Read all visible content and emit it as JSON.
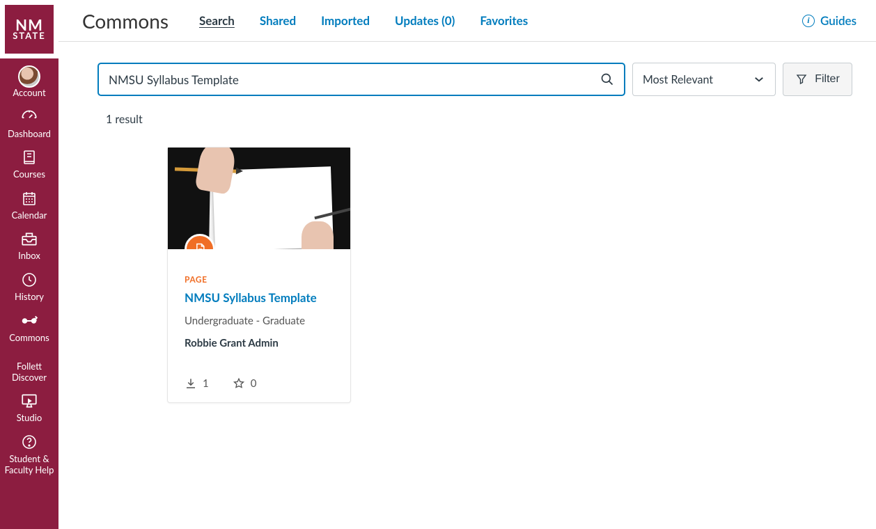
{
  "brand": {
    "acronym_top": "NM",
    "acronym_bottom": "STATE"
  },
  "sidebar": {
    "items": [
      {
        "label": "Account",
        "icon": "avatar"
      },
      {
        "label": "Dashboard",
        "icon": "gauge"
      },
      {
        "label": "Courses",
        "icon": "book"
      },
      {
        "label": "Calendar",
        "icon": "calendar"
      },
      {
        "label": "Inbox",
        "icon": "inbox"
      },
      {
        "label": "History",
        "icon": "clock"
      },
      {
        "label": "Commons",
        "icon": "share"
      },
      {
        "label": "Follett Discover",
        "icon": "none"
      },
      {
        "label": "Studio",
        "icon": "screen"
      },
      {
        "label": "Student & Faculty Help",
        "icon": "help"
      }
    ]
  },
  "header": {
    "title": "Commons",
    "tabs": [
      {
        "label": "Search",
        "active": true
      },
      {
        "label": "Shared",
        "active": false
      },
      {
        "label": "Imported",
        "active": false
      },
      {
        "label": "Updates (0)",
        "active": false
      },
      {
        "label": "Favorites",
        "active": false
      }
    ],
    "guides_label": "Guides"
  },
  "search": {
    "value": "NMSU Syllabus Template",
    "placeholder": "Search"
  },
  "sort": {
    "selected": "Most Relevant"
  },
  "filter": {
    "label": "Filter"
  },
  "results": {
    "count_text": "1 result",
    "items": [
      {
        "type_label": "PAGE",
        "title": "NMSU Syllabus Template",
        "level": "Undergraduate - Graduate",
        "author": "Robbie Grant Admin",
        "downloads": "1",
        "favorites": "0"
      }
    ]
  }
}
